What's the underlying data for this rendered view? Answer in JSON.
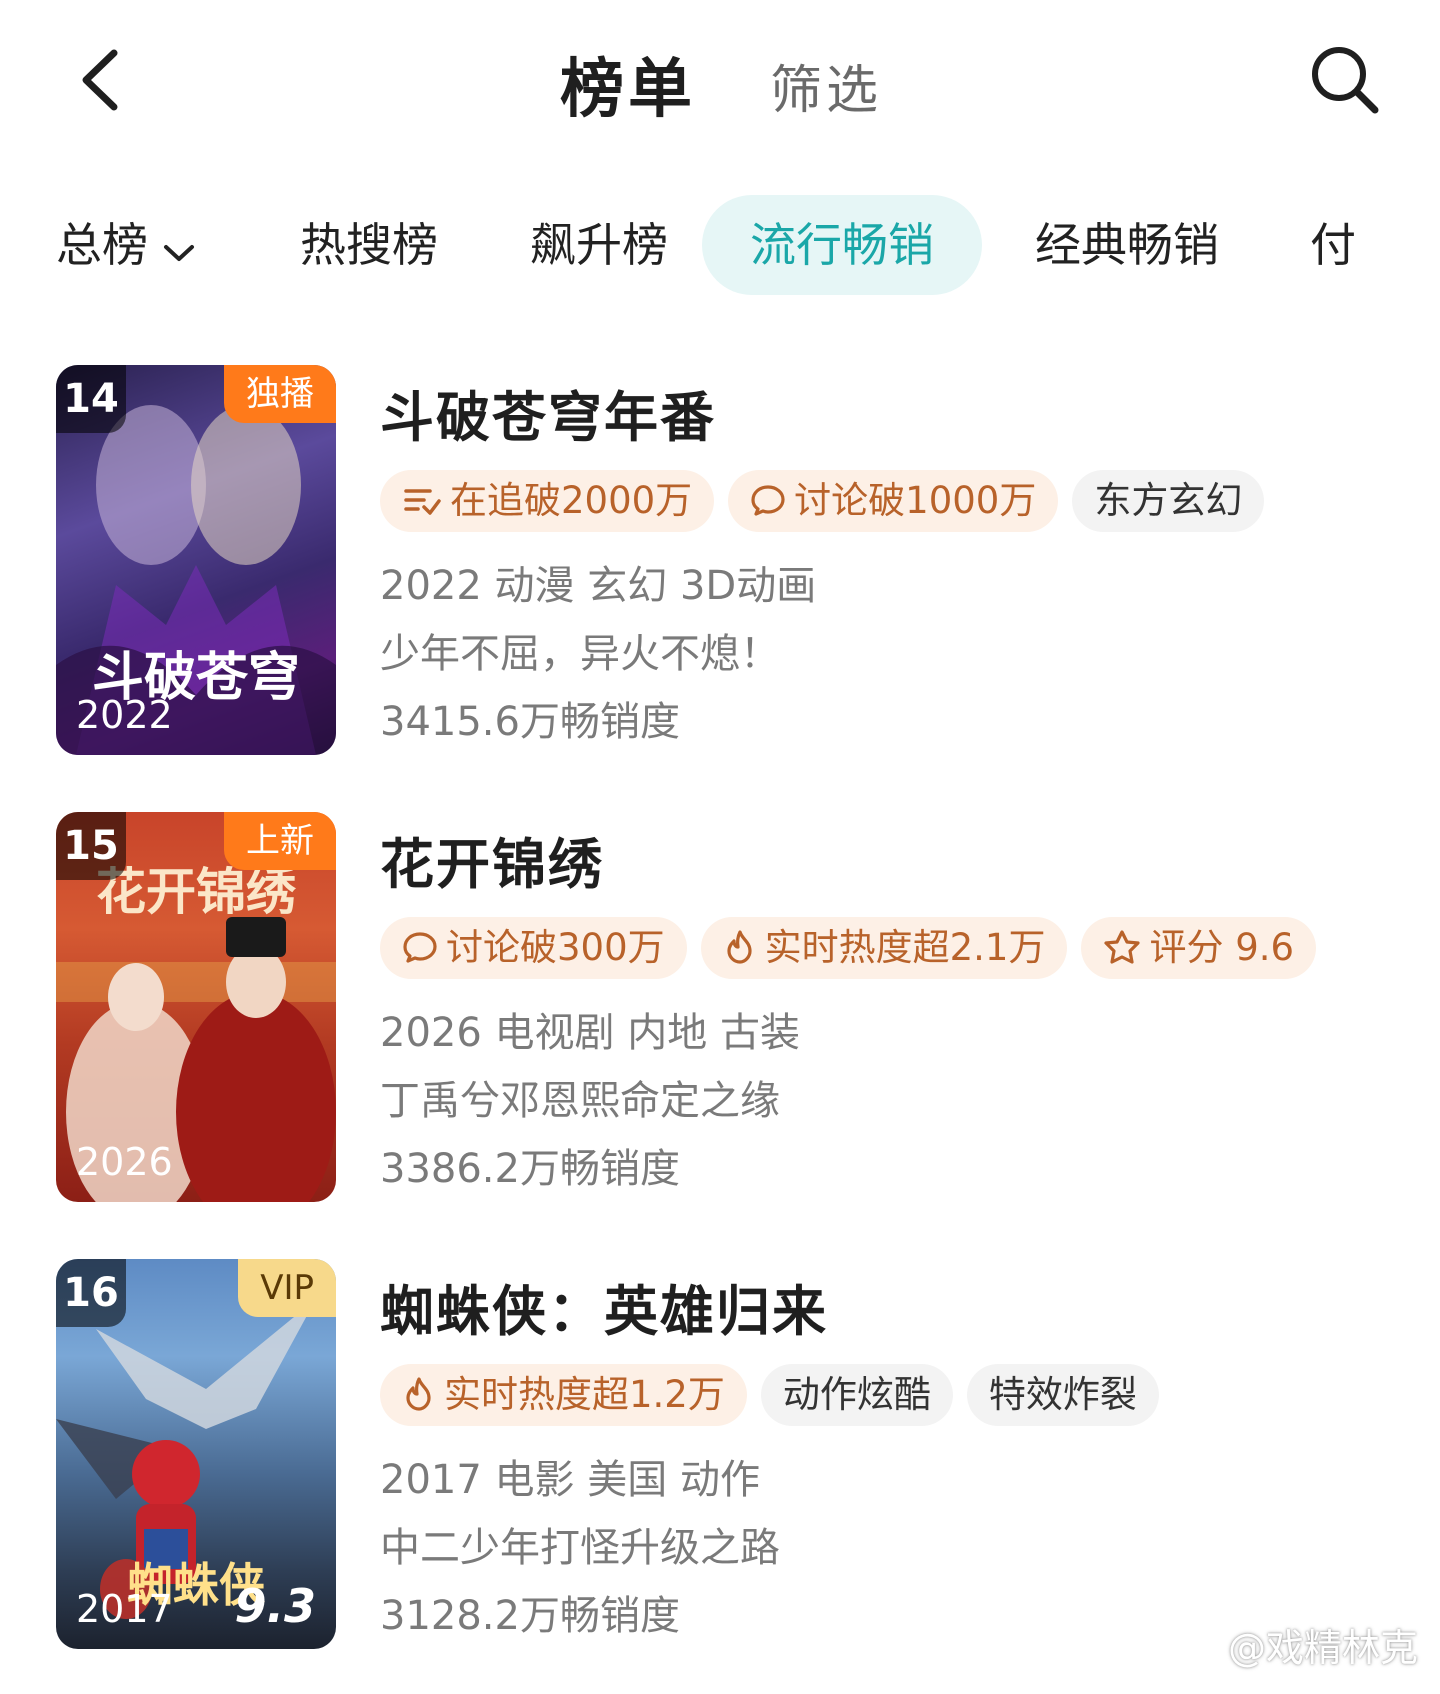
{
  "header": {
    "title": "榜单",
    "filter_label": "筛选",
    "back_icon": "chevron-left-icon",
    "search_icon": "search-icon"
  },
  "tabs": [
    {
      "label": "总榜",
      "has_dropdown": true
    },
    {
      "label": "热搜榜"
    },
    {
      "label": "飙升榜"
    },
    {
      "label": "流行畅销",
      "active": true
    },
    {
      "label": "经典畅销"
    },
    {
      "label": "付"
    }
  ],
  "colors": {
    "accent": "#1aa7a8",
    "accent_bg": "#e6f6f6",
    "hot_tag_bg": "#fdf0e6",
    "hot_tag_text": "#b8622a",
    "badge_orange": "#ff7a1a",
    "badge_vip": "#f7d98b"
  },
  "items": [
    {
      "rank": "14",
      "badge": "独播",
      "poster_year": "2022",
      "poster_title": "斗破苍穹",
      "title": "斗破苍穹年番",
      "tags": [
        {
          "icon": "follow-list-icon",
          "text": "在追破2000万",
          "style": "hot"
        },
        {
          "icon": "comment-icon",
          "text": "讨论破1000万",
          "style": "hot"
        },
        {
          "text": "东方玄幻",
          "style": "plain"
        }
      ],
      "meta": "2022 动漫 玄幻 3D动画",
      "desc": "少年不屈，异火不熄！",
      "sales": "3415.6万畅销度"
    },
    {
      "rank": "15",
      "badge": "上新",
      "poster_year": "2026",
      "poster_title": "花开锦绣",
      "title": "花开锦绣",
      "tags": [
        {
          "icon": "comment-icon",
          "text": "讨论破300万",
          "style": "hot"
        },
        {
          "icon": "flame-icon",
          "text": "实时热度超2.1万",
          "style": "hot"
        },
        {
          "icon": "star-icon",
          "text": "评分 9.6",
          "style": "hot"
        }
      ],
      "meta": "2026 电视剧 内地 古装",
      "desc": "丁禹兮邓恩熙命定之缘",
      "sales": "3386.2万畅销度"
    },
    {
      "rank": "16",
      "badge": "VIP",
      "poster_year": "2017",
      "poster_score": "9.3",
      "poster_title": "蜘蛛侠",
      "title": "蜘蛛侠：英雄归来",
      "tags": [
        {
          "icon": "flame-icon",
          "text": "实时热度超1.2万",
          "style": "hot"
        },
        {
          "text": "动作炫酷",
          "style": "plain"
        },
        {
          "text": "特效炸裂",
          "style": "plain"
        }
      ],
      "meta": "2017 电影 美国 动作",
      "desc": "中二少年打怪升级之路",
      "sales": "3128.2万畅销度"
    }
  ],
  "watermark": "@戏精林克"
}
